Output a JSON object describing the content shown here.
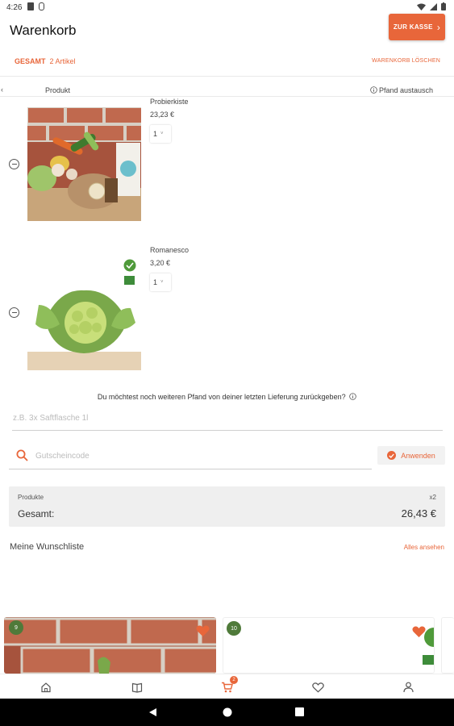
{
  "status_bar": {
    "time": "4:26"
  },
  "header": {
    "title": "Warenkorb",
    "checkout_label": "ZUR KASSE",
    "checkout_chevron": "›"
  },
  "summary": {
    "total_label": "GESAMT",
    "item_count": "2 Artikel",
    "clear_label": "WARENKORB LÖSCHEN"
  },
  "columns": {
    "product": "Produkt",
    "deposit_swap": "Pfand austausch"
  },
  "items": [
    {
      "name": "Probierkiste",
      "price": "23,23 €",
      "quantity": "1"
    },
    {
      "name": "Romanesco",
      "price": "3,20 €",
      "quantity": "1"
    }
  ],
  "deposit": {
    "question": "Du möchtest noch weiteren Pfand von deiner letzten Lieferung zurückgeben?",
    "placeholder": "z.B. 3x Saftflasche 1l"
  },
  "coupon": {
    "placeholder": "Gutscheincode",
    "apply_label": "Anwenden"
  },
  "totals": {
    "products_label": "Produkte",
    "products_count": "x2",
    "total_label": "Gesamt:",
    "total_value": "26,43 €"
  },
  "wishlist": {
    "title": "Meine Wunschliste",
    "see_all": "Alles ansehen",
    "cards": [
      {
        "badge": "9"
      },
      {
        "badge": "10"
      }
    ]
  },
  "colors": {
    "accent": "#e8663a",
    "badge_green": "#4f7a3a"
  },
  "icons": {
    "nav": [
      "home-icon",
      "catalog-icon",
      "cart-icon",
      "heart-icon",
      "profile-icon"
    ],
    "cart_badge": "2"
  }
}
